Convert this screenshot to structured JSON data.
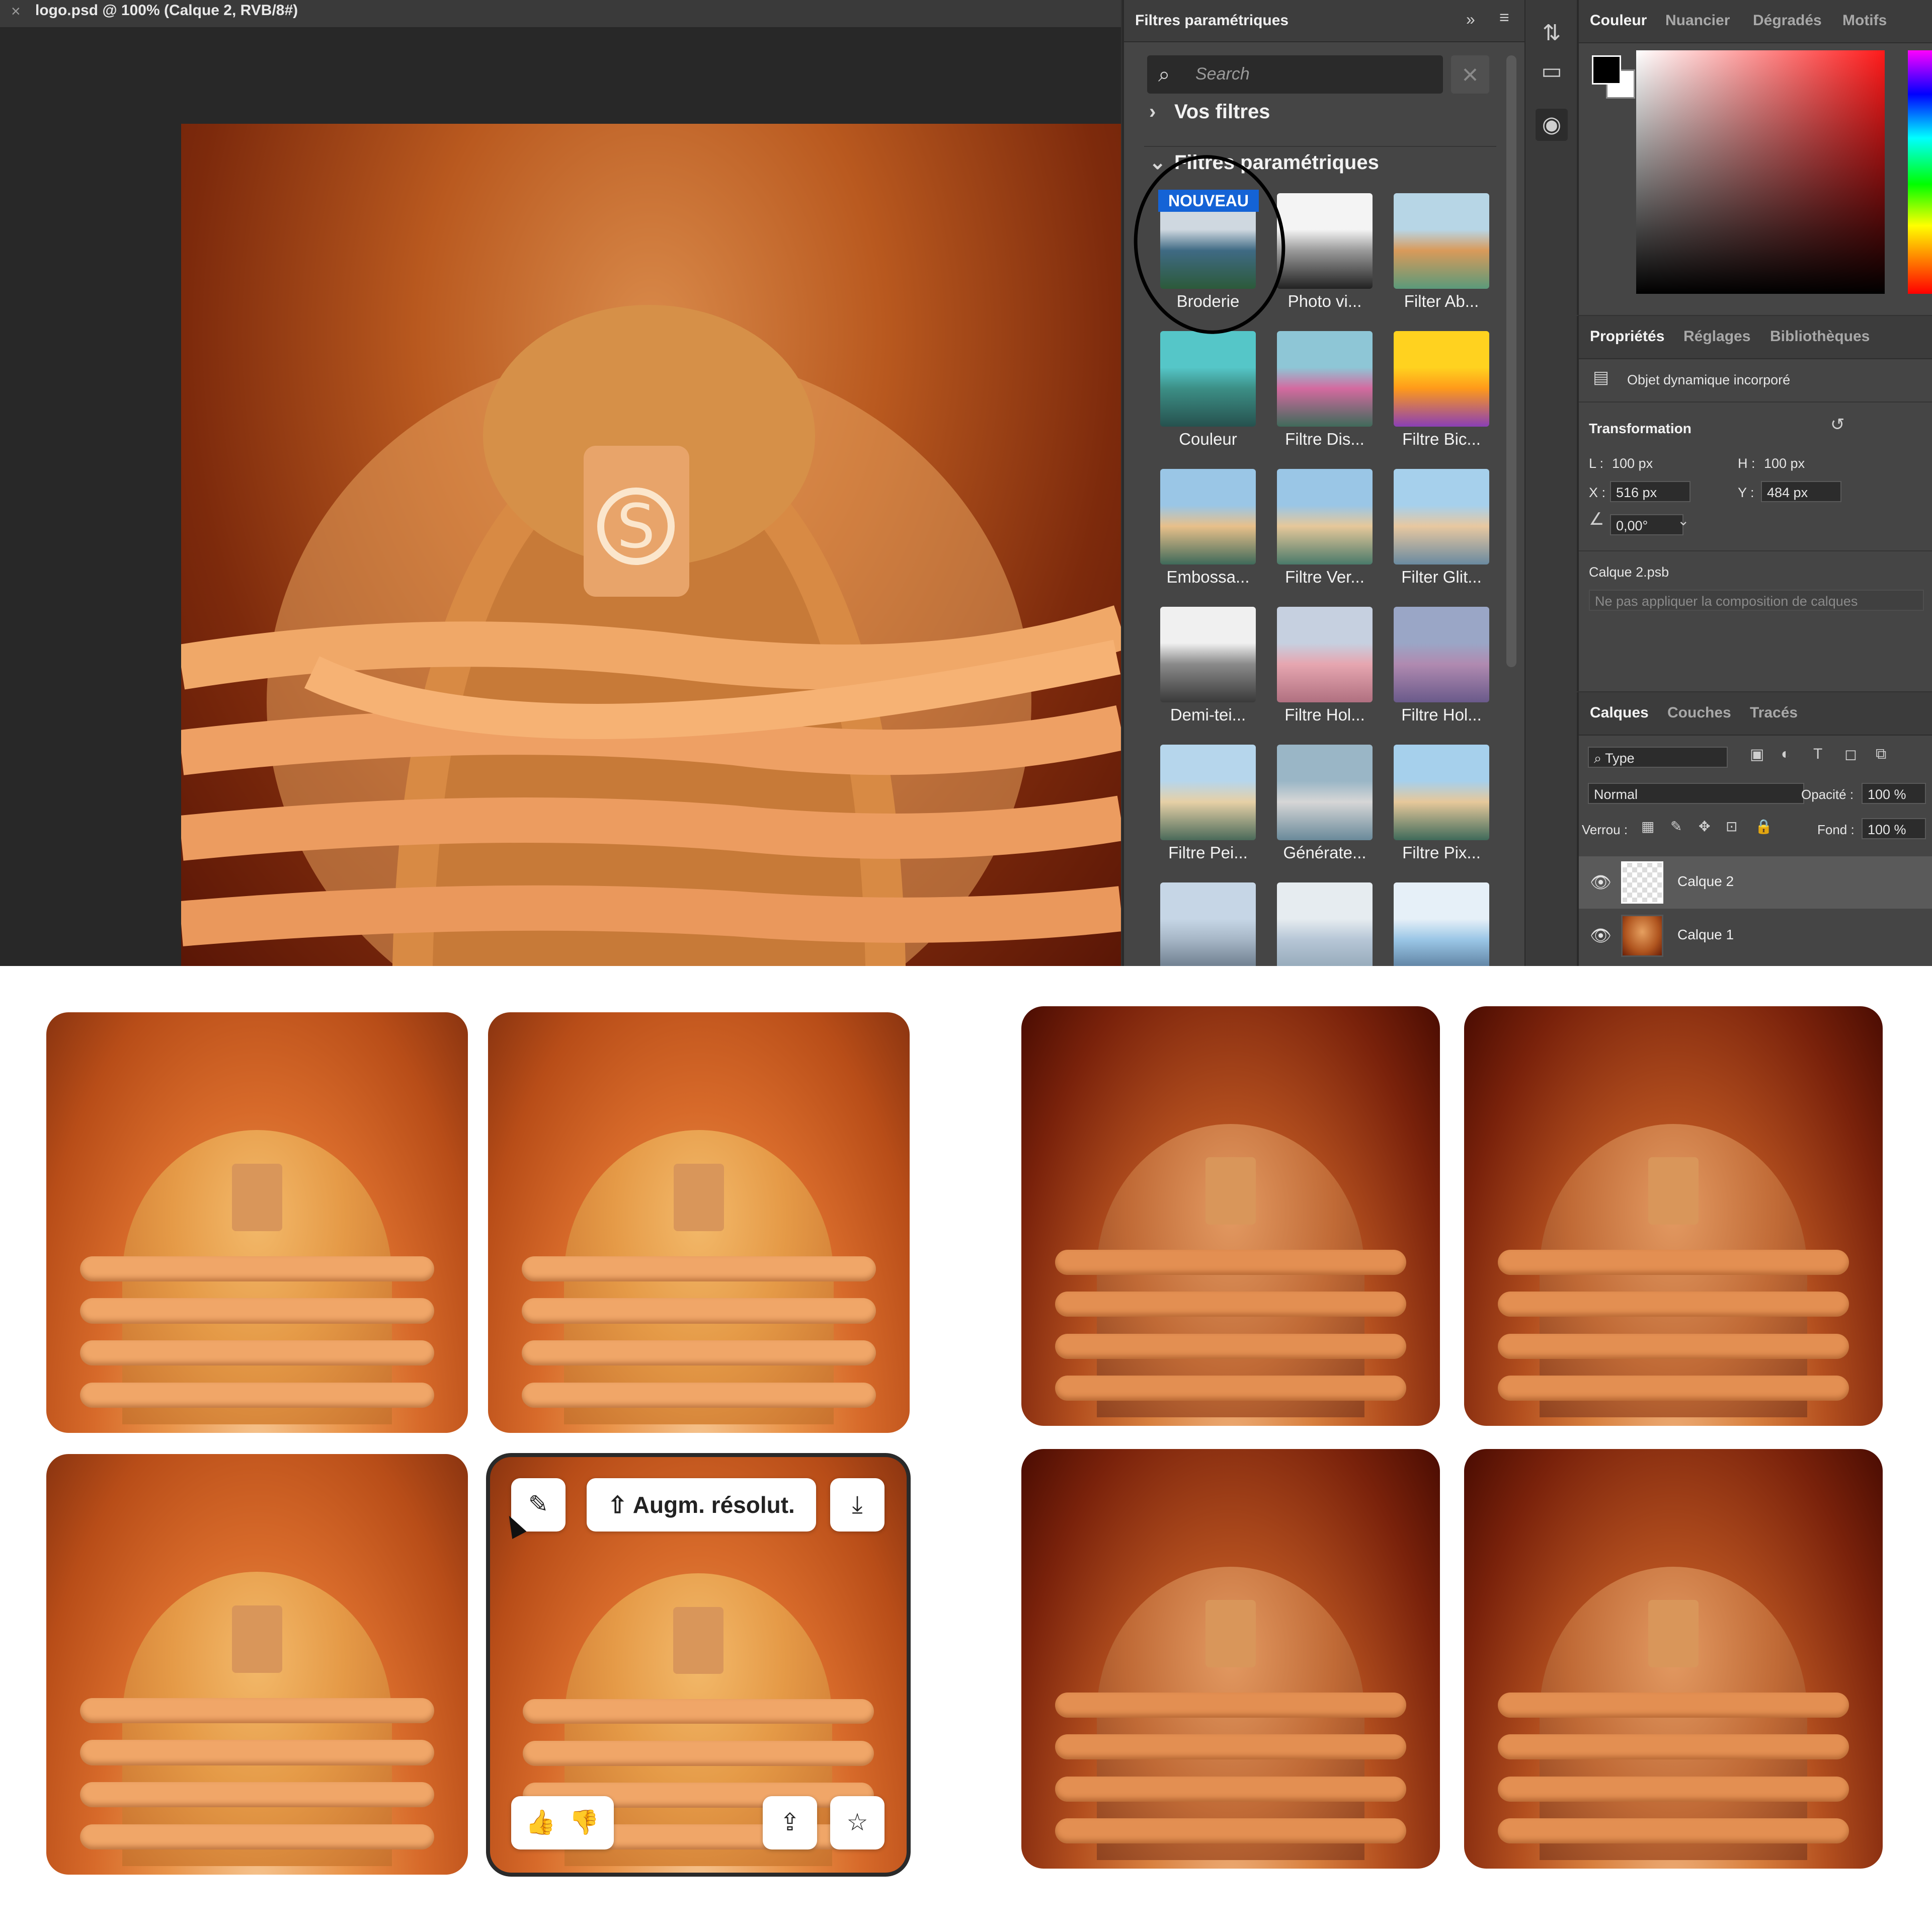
{
  "document": {
    "tab_title": "logo.psd @ 100% (Calque 2, RVB/8#)"
  },
  "neural_filters": {
    "panel_title": "Filtres paramétriques",
    "search_placeholder": "Search",
    "section_yours": "Vos filtres",
    "section_all": "Filtres paramétriques",
    "new_badge": "NOUVEAU",
    "filters": [
      {
        "label": "Broderie",
        "palette": [
          "#cfd8e0",
          "#3f6a84",
          "#2c5a3a"
        ]
      },
      {
        "label": "Photo vi...",
        "palette": [
          "#f4f4f4",
          "#9a9a9a",
          "#222222"
        ]
      },
      {
        "label": "Filter Ab...",
        "palette": [
          "#b7d6e6",
          "#d99a5a",
          "#5b9a7a"
        ]
      },
      {
        "label": "Couleur",
        "palette": [
          "#55c6c8",
          "#3c8f86",
          "#26514e"
        ]
      },
      {
        "label": "Filtre Dis...",
        "palette": [
          "#8ec6d6",
          "#d46aa0",
          "#3f6a5a"
        ]
      },
      {
        "label": "Filtre Bic...",
        "palette": [
          "#ffd21f",
          "#ff9a1a",
          "#8a3fb6"
        ]
      },
      {
        "label": "Embossa...",
        "palette": [
          "#9ac6e6",
          "#e8c08a",
          "#3f6a5a"
        ]
      },
      {
        "label": "Filtre Ver...",
        "palette": [
          "#9ac6e6",
          "#e6c89a",
          "#4a7a6a"
        ]
      },
      {
        "label": "Filter Glit...",
        "palette": [
          "#a6d0ec",
          "#e8c8a0",
          "#6a8aa0"
        ]
      },
      {
        "label": "Demi-tei...",
        "palette": [
          "#f0f0f0",
          "#8a8a8a",
          "#3a3a3a"
        ]
      },
      {
        "label": "Filtre Hol...",
        "palette": [
          "#c6d0e0",
          "#e6a6b0",
          "#b07080"
        ]
      },
      {
        "label": "Filtre Hol...",
        "palette": [
          "#9aa6c6",
          "#b08ab0",
          "#6a5a8a"
        ]
      },
      {
        "label": "Filtre Pei...",
        "palette": [
          "#b6d6ec",
          "#e6d0a6",
          "#4a6a5a"
        ]
      },
      {
        "label": "Générate...",
        "palette": [
          "#9ab6c6",
          "#d6d6d6",
          "#6a8a9a"
        ]
      },
      {
        "label": "Filtre Pix...",
        "palette": [
          "#a6d0ec",
          "#e6c89a",
          "#3f6a5a"
        ]
      },
      {
        "label": "",
        "palette": [
          "#c6d6e6",
          "#a6b6c6",
          "#5a6a7a"
        ]
      },
      {
        "label": "",
        "palette": [
          "#e6ecf0",
          "#b6c6d6",
          "#8aa0b0"
        ]
      },
      {
        "label": "",
        "palette": [
          "#e6f0f8",
          "#9ac6e6",
          "#4a6a8a"
        ]
      }
    ]
  },
  "color_panel": {
    "tabs": [
      "Couleur",
      "Nuancier",
      "Dégradés",
      "Motifs"
    ]
  },
  "properties_panel": {
    "tabs": [
      "Propriétés",
      "Réglages",
      "Bibliothèques"
    ],
    "object_type": "Objet dynamique incorporé",
    "transform_heading": "Transformation",
    "w_label": "L :",
    "w_value": "100 px",
    "h_label": "H :",
    "h_value": "100 px",
    "x_label": "X :",
    "x_value": "516 px",
    "y_label": "Y :",
    "y_value": "484 px",
    "angle_value": "0,00°",
    "file_name": "Calque 2.psb",
    "comp_select": "Ne pas appliquer la composition de calques"
  },
  "layers_panel": {
    "tabs": [
      "Calques",
      "Couches",
      "Tracés"
    ],
    "filter_type": "Type",
    "blend_mode": "Normal",
    "opacity_label": "Opacité :",
    "opacity_value": "100 %",
    "lock_label": "Verrou :",
    "fill_label": "Fond :",
    "fill_value": "100 %",
    "layers": [
      {
        "name": "Calque 2"
      },
      {
        "name": "Calque 1"
      }
    ]
  },
  "results": {
    "upscale_label": "Augm. résolut."
  }
}
